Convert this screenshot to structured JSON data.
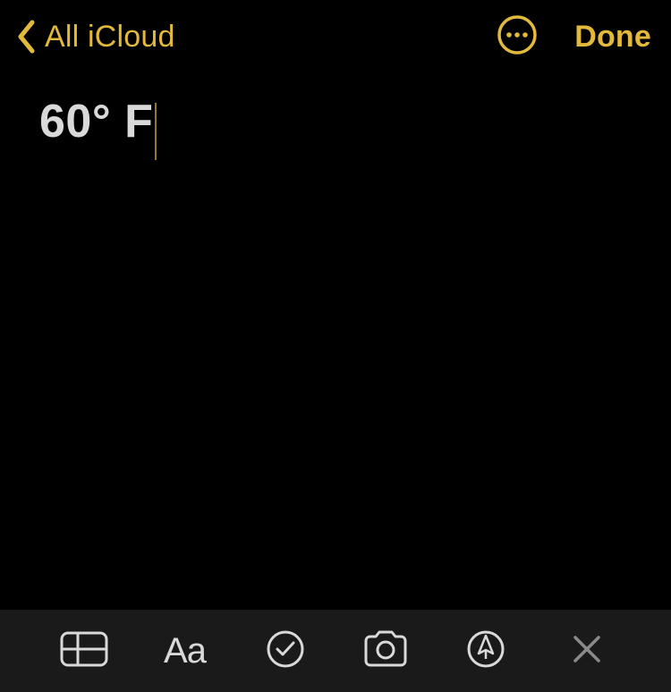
{
  "header": {
    "back_label": "All iCloud",
    "done_label": "Done"
  },
  "note": {
    "title": "60° F"
  },
  "toolbar": {
    "format_label": "Aa"
  },
  "colors": {
    "accent": "#e2b93b",
    "text": "#d9d9d9",
    "toolbar_bg": "#1a1a1a"
  }
}
